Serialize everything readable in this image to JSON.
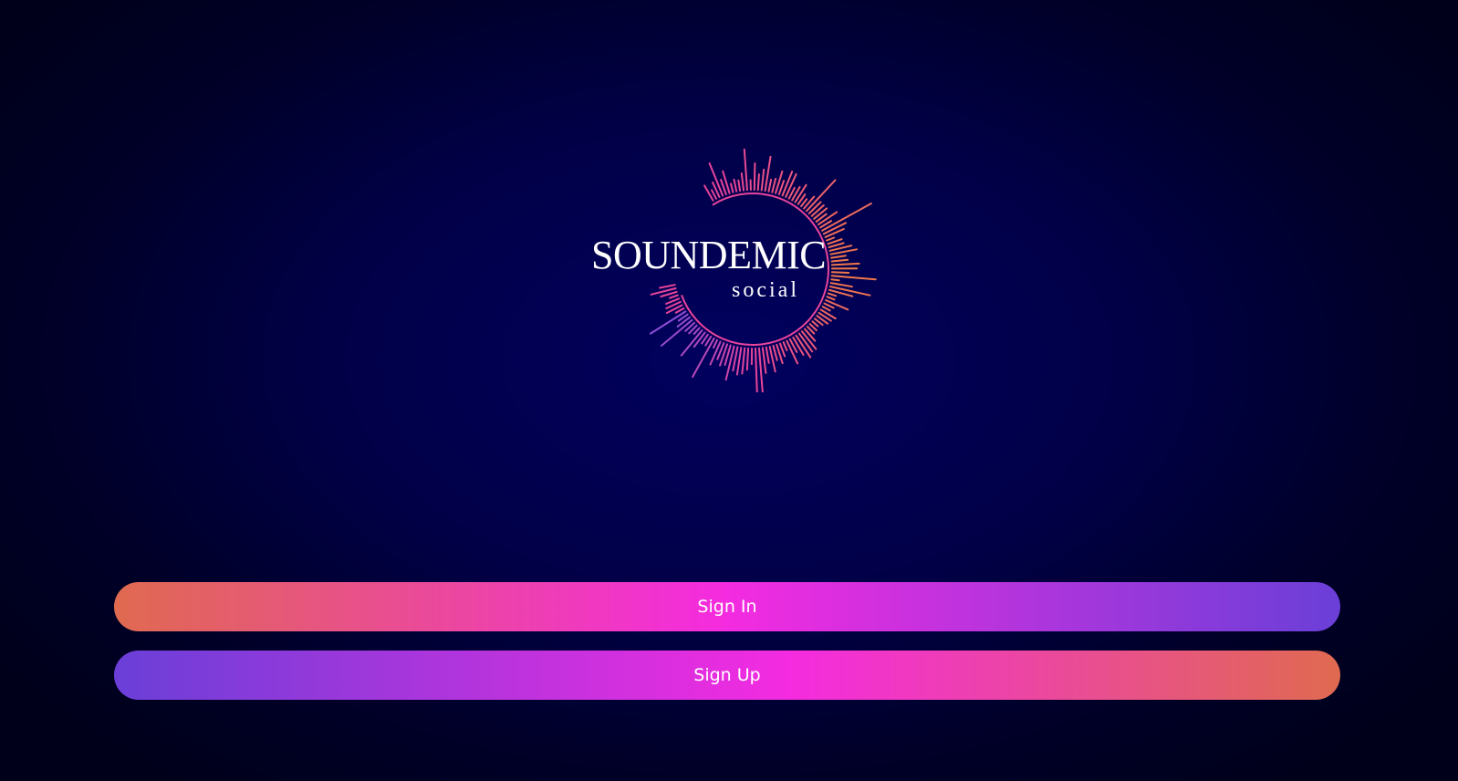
{
  "logo": {
    "title": "SOUNDEMIC",
    "subtitle": "social",
    "icon": "sound-wave-circle-icon",
    "colors": {
      "orange": "#f07a45",
      "pink": "#e8449a",
      "purple": "#8a4ed8"
    }
  },
  "actions": {
    "sign_in_label": "Sign In",
    "sign_up_label": "Sign Up"
  },
  "theme": {
    "background": "#010046",
    "button_start": "#e06a50",
    "button_mid": "#f42be0",
    "button_end": "#6a3fd8"
  }
}
